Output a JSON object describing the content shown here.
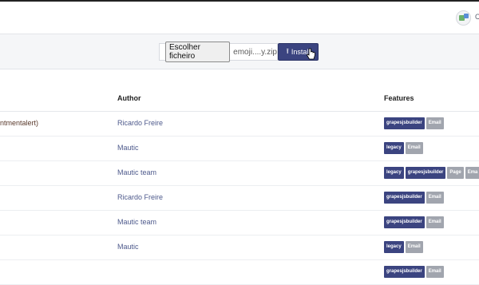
{
  "header": {
    "user_initial": "C"
  },
  "toolbar": {
    "choose_file_label": "Escolher ficheiro",
    "file_name": "emoji....y.zip",
    "install_label": "Install"
  },
  "table": {
    "columns": [
      "Author",
      "Features"
    ],
    "rows": [
      {
        "name": "ntmentalert)",
        "author": "Ricardo Freire",
        "features": [
          "grapesjsbuilder",
          "Email"
        ]
      },
      {
        "name": "",
        "author": "Mautic",
        "features": [
          "legacy",
          "Email"
        ]
      },
      {
        "name": "",
        "author": "Mautic team",
        "features": [
          "legacy",
          "grapesjsbuilder",
          "Page",
          "Ema"
        ]
      },
      {
        "name": "",
        "author": "Ricardo Freire",
        "features": [
          "grapesjsbuilder",
          "Email"
        ]
      },
      {
        "name": "",
        "author": "Mautic team",
        "features": [
          "grapesjsbuilder",
          "Email"
        ]
      },
      {
        "name": "",
        "author": "Mautic",
        "features": [
          "legacy",
          "Email"
        ]
      },
      {
        "name": "",
        "author": "",
        "features": [
          "grapesjsbuilder",
          "Email"
        ]
      }
    ]
  },
  "colors": {
    "accent": "#3b4480",
    "muted_badge": "#a1a5ae",
    "link": "#4e5a8c"
  }
}
